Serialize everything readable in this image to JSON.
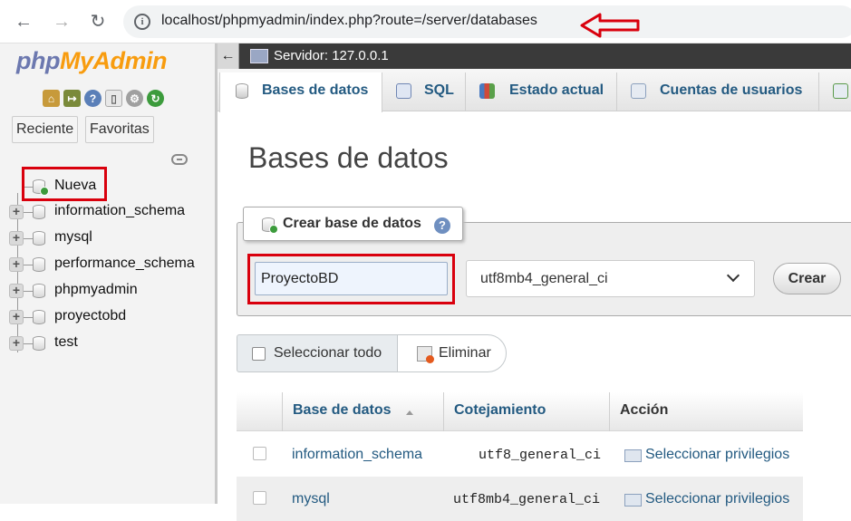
{
  "browser": {
    "url": "localhost/phpmyadmin/index.php?route=/server/databases",
    "back_icon": "arrow-left",
    "forward_icon": "arrow-right",
    "reload_icon": "reload",
    "info_icon": "info-circle"
  },
  "sidebar": {
    "logo_php": "php",
    "logo_myadmin": "MyAdmin",
    "quick_icons": [
      "home-icon",
      "logout-icon",
      "help-icon",
      "docs-icon",
      "settings-icon",
      "reload-icon"
    ],
    "tabs": [
      "Reciente",
      "Favoritas"
    ],
    "tree": [
      {
        "label": "Nueva",
        "kind": "new"
      },
      {
        "label": "information_schema",
        "kind": "db"
      },
      {
        "label": "mysql",
        "kind": "db"
      },
      {
        "label": "performance_schema",
        "kind": "db"
      },
      {
        "label": "phpmyadmin",
        "kind": "db"
      },
      {
        "label": "proyectobd",
        "kind": "db"
      },
      {
        "label": "test",
        "kind": "db"
      }
    ]
  },
  "server_bar": {
    "label": "Servidor: 127.0.0.1"
  },
  "menu": {
    "tabs": [
      {
        "label": "Bases de datos",
        "icon": "database-icon",
        "active": true
      },
      {
        "label": "SQL",
        "icon": "sql-icon",
        "active": false
      },
      {
        "label": "Estado actual",
        "icon": "status-icon",
        "active": false
      },
      {
        "label": "Cuentas de usuarios",
        "icon": "users-icon",
        "active": false
      }
    ]
  },
  "main": {
    "title": "Bases de datos",
    "create": {
      "legend": "Crear base de datos",
      "name_value": "ProyectoBD",
      "collation_value": "utf8mb4_general_ci",
      "button": "Crear"
    },
    "bulk": {
      "select_all": "Seleccionar todo",
      "delete": "Eliminar"
    },
    "table": {
      "headers": [
        "Base de datos",
        "Cotejamiento",
        "Acción"
      ],
      "rows": [
        {
          "name": "information_schema",
          "collation": "utf8_general_ci",
          "action": "Seleccionar privilegios"
        },
        {
          "name": "mysql",
          "collation": "utf8mb4_general_ci",
          "action": "Seleccionar privilegios"
        }
      ]
    }
  },
  "colors": {
    "annotation_red": "#d9000d",
    "link_blue": "#235a81",
    "logo_blue": "#6c78af",
    "logo_orange": "#f89c0e"
  }
}
